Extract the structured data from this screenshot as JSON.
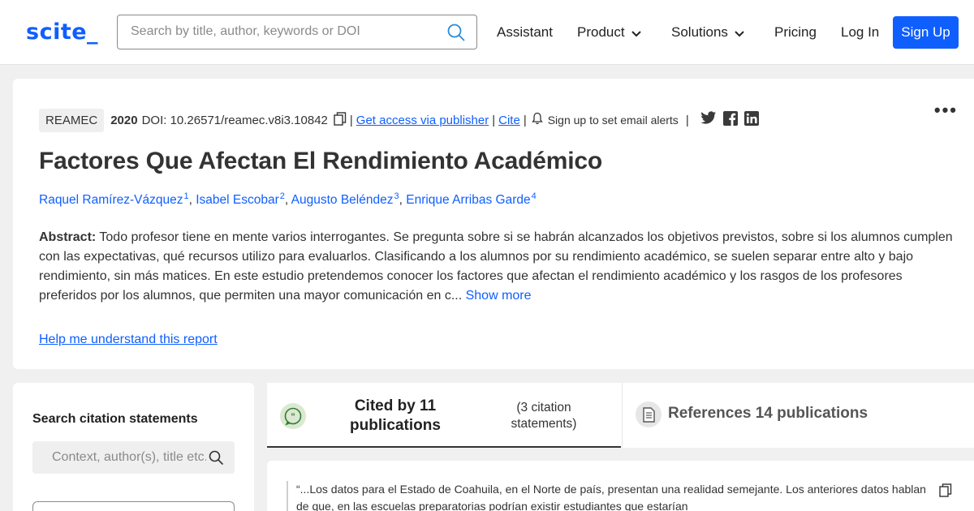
{
  "header": {
    "logo": "scite_",
    "search_placeholder": "Search by title, author, keywords or DOI",
    "nav": {
      "assistant": "Assistant",
      "product": "Product",
      "solutions": "Solutions",
      "pricing": "Pricing",
      "login": "Log In",
      "signup": "Sign Up"
    },
    "colors": {
      "brand": "#0f5fff"
    }
  },
  "paper": {
    "journal": "REAMEC",
    "year": "2020",
    "doi": "DOI: 10.26571/reamec.v8i3.10842",
    "access_link": "Get access via publisher",
    "cite_link": "Cite",
    "alerts": "Sign up to set email alerts",
    "title": "Factores Que Afectan El Rendimiento Académico",
    "authors": [
      {
        "name": "Raquel Ramírez-Vázquez",
        "num": "1"
      },
      {
        "name": "Isabel Escobar",
        "num": "2"
      },
      {
        "name": "Augusto Beléndez",
        "num": "3"
      },
      {
        "name": "Enrique Arribas Garde",
        "num": "4"
      }
    ],
    "abstract_label": "Abstract:",
    "abstract_text": "Todo profesor tiene en mente varios interrogantes. Se pregunta sobre si se habrán alcanzados los objetivos previstos, sobre si los alumnos cumplen con las expectativas, qué recursos utilizo para evaluarlos. Clasificando a los alumnos por su rendimiento académico, se suelen separar entre alto y bajo rendimiento, sin más matices. En este estudio pretendemos conocer los factores que afectan el rendimiento académico y los rasgos de los profesores preferidos por los alumnos, que permiten una mayor comunicación en c...",
    "show_more": "Show more",
    "help_link": "Help me understand this report"
  },
  "sidebar": {
    "title": "Search citation statements",
    "search_placeholder": "Context, author(s), title etc."
  },
  "tabs": {
    "cited_label": "Cited by 11 publications",
    "cited_sub": "(3 citation statements)",
    "references_label": "References 14 publications"
  },
  "statement": {
    "text": "“...Los datos para el Estado de Coahuila, en el Norte de país, presentan una realidad semejante. Los anteriores datos hablan de que, en las escuelas preparatorias podrían existir estudiantes que estarían"
  }
}
